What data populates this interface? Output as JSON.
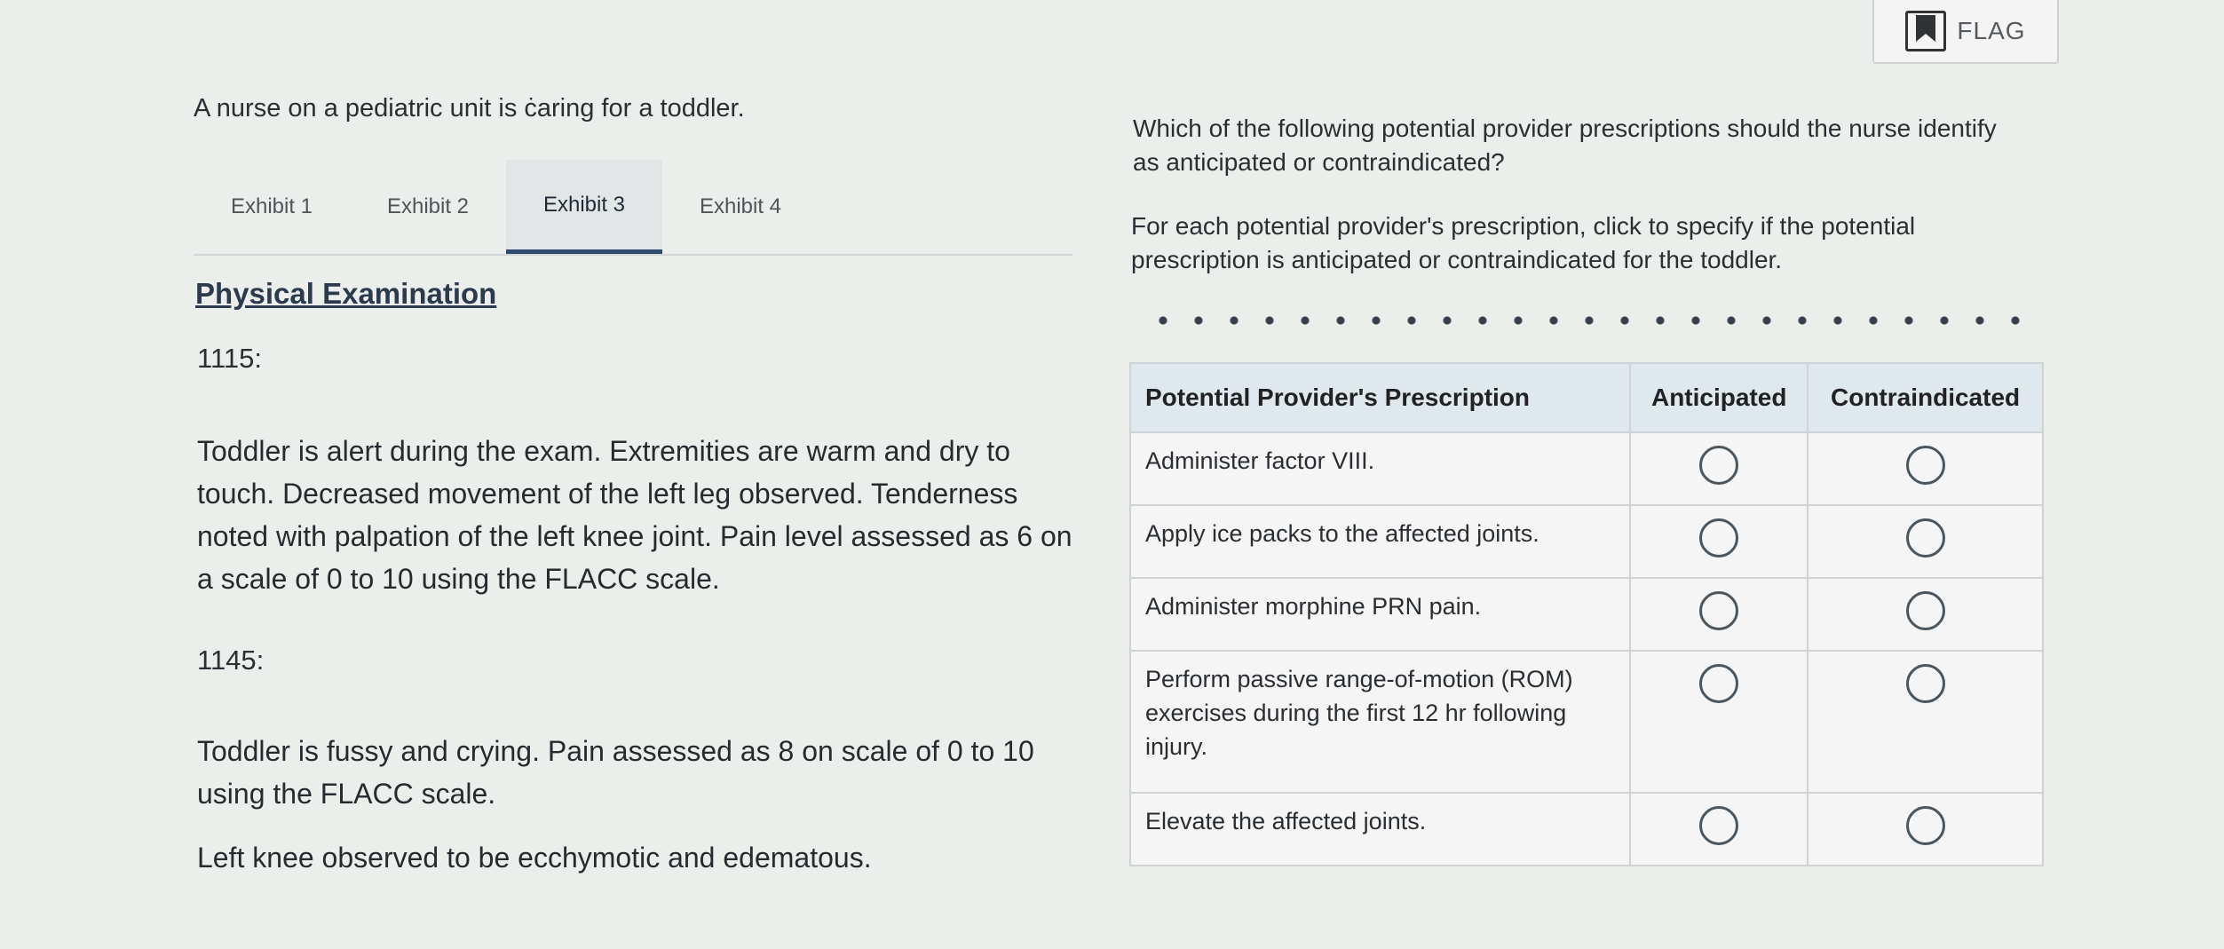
{
  "flag": {
    "label": "FLAG",
    "icon": "bookmark-icon"
  },
  "scenario": {
    "intro": "A nurse on a pediatric unit is ċaring for a toddler."
  },
  "tabs": [
    {
      "label": "Exhibit 1",
      "active": false
    },
    {
      "label": "Exhibit 2",
      "active": false
    },
    {
      "label": "Exhibit 3",
      "active": true
    },
    {
      "label": "Exhibit 4",
      "active": false
    }
  ],
  "exhibit": {
    "title": "Physical Examination",
    "entries": [
      {
        "time": "1115:",
        "paragraphs": [
          "Toddler is alert during the exam. Extremities are warm and dry to touch. Decreased movement of the left leg observed. Tenderness noted with palpation of the left knee joint. Pain level assessed as 6 on a scale of 0 to 10 using the FLACC scale."
        ]
      },
      {
        "time": "1145:",
        "paragraphs": [
          "Toddler is fussy and crying. Pain assessed as 8 on scale of 0 to 10 using the FLACC scale.",
          "Left knee observed to be ecchymotic and edematous."
        ]
      }
    ]
  },
  "question": {
    "prompt": "Which of the following potential provider prescriptions should the nurse identify as anticipated or contraindicated?",
    "instruction": "For each potential provider's prescription, click to specify if the potential prescription is anticipated or contraindicated for the toddler."
  },
  "table": {
    "headers": [
      "Potential Provider's Prescription",
      "Anticipated",
      "Contraindicated"
    ],
    "rows": [
      "Administer factor VIII.",
      "Apply ice packs to the affected joints.",
      "Administer morphine PRN pain.",
      "Perform passive range-of-motion (ROM) exercises during the first 12 hr following injury.",
      "Elevate the affected joints."
    ]
  }
}
